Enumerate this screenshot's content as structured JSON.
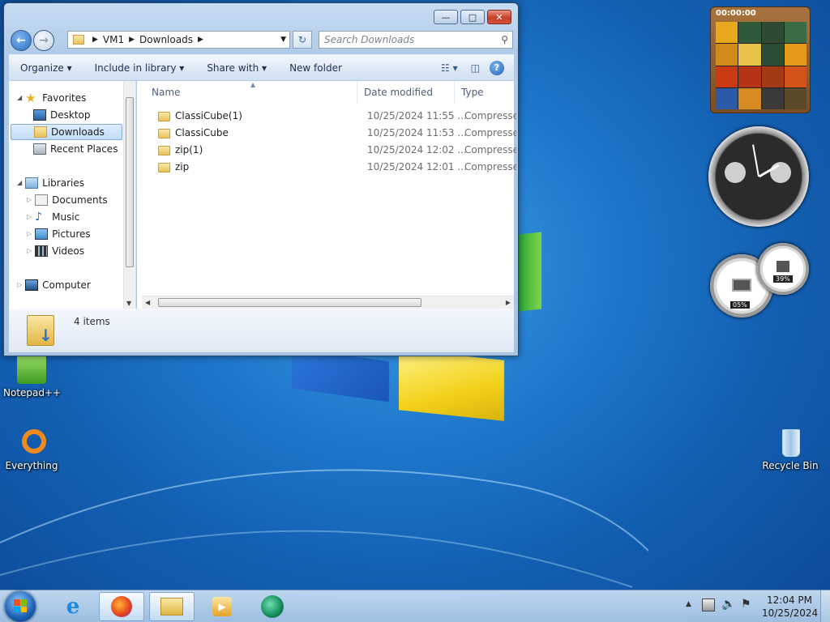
{
  "desktop": {
    "icons": [
      {
        "label": "Notepad++"
      },
      {
        "label": "Everything"
      },
      {
        "label": "Recycle Bin"
      }
    ]
  },
  "window": {
    "address": {
      "root": "VM1",
      "folder": "Downloads"
    },
    "search_placeholder": "Search Downloads",
    "commands": {
      "organize": "Organize",
      "include": "Include in library",
      "share": "Share with",
      "newfolder": "New folder"
    },
    "nav": {
      "favorites": "Favorites",
      "desktop": "Desktop",
      "downloads": "Downloads",
      "recent": "Recent Places",
      "libraries": "Libraries",
      "documents": "Documents",
      "music": "Music",
      "pictures": "Pictures",
      "videos": "Videos",
      "computer": "Computer"
    },
    "columns": {
      "name": "Name",
      "date": "Date modified",
      "type": "Type"
    },
    "files": [
      {
        "name": "ClassiCube(1)",
        "date": "10/25/2024 11:55 ...",
        "type": "Compressed"
      },
      {
        "name": "ClassiCube",
        "date": "10/25/2024 11:53 ...",
        "type": "Compressed"
      },
      {
        "name": "zip(1)",
        "date": "10/25/2024 12:02 ...",
        "type": "Compressed"
      },
      {
        "name": "zip",
        "date": "10/25/2024 12:01 ...",
        "type": "Compressed"
      }
    ],
    "status": "4 items"
  },
  "gadgets": {
    "puzzle_timer": "00:00:00",
    "cpu_percent": "05%",
    "mem_percent": "39%"
  },
  "taskbar": {
    "time": "12:04 PM",
    "date": "10/25/2024"
  },
  "colors": {
    "accent": "#1f78cc",
    "taskbar": "#b7d0ea",
    "close": "#c8402a"
  }
}
